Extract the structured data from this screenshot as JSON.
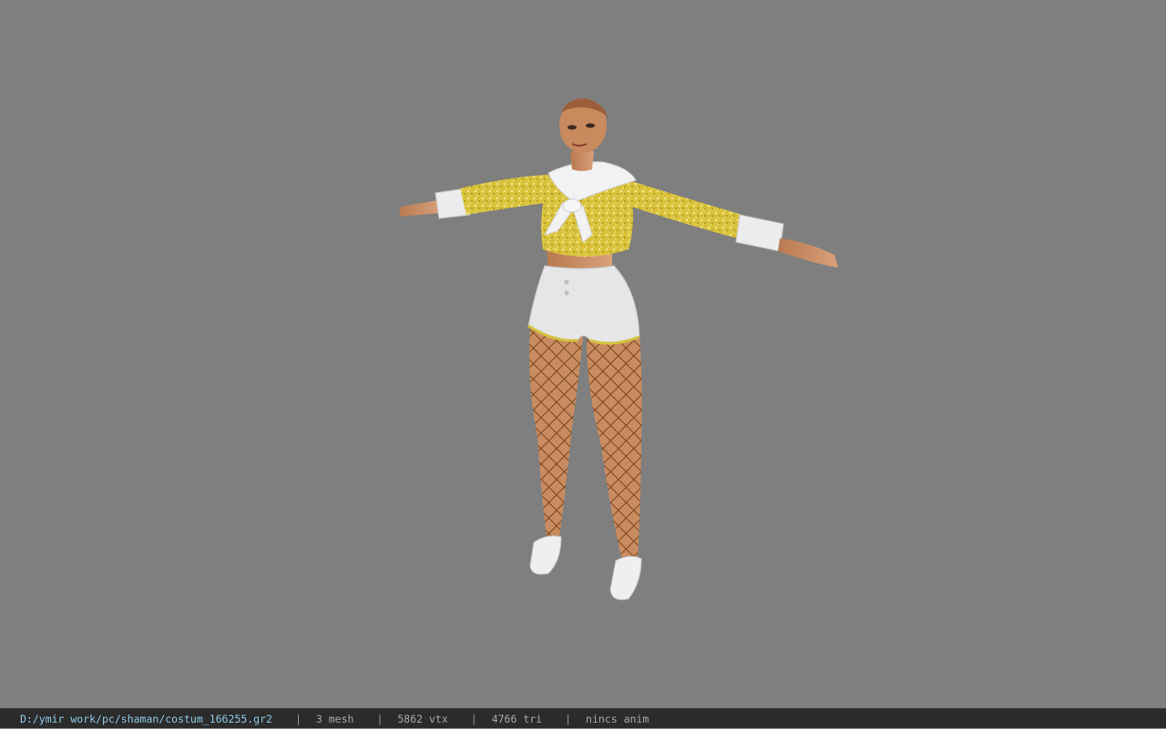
{
  "viewer": {
    "background_color": "#7f7f7f",
    "model_icon": "character-model-icon"
  },
  "statusbar": {
    "file_path": "D:/ymir work/pc/shaman/costum_166255.gr2",
    "separator": "|",
    "mesh_count": "3 mesh",
    "vertex_count": "5862 vtx",
    "triangle_count": "4766 tri",
    "animation": "nincs anim"
  },
  "colors": {
    "top_yellow": "#d8c238",
    "white_cloth": "#e6e6e6",
    "skin": "#c98a5e",
    "fishnet": "#a0602d"
  }
}
